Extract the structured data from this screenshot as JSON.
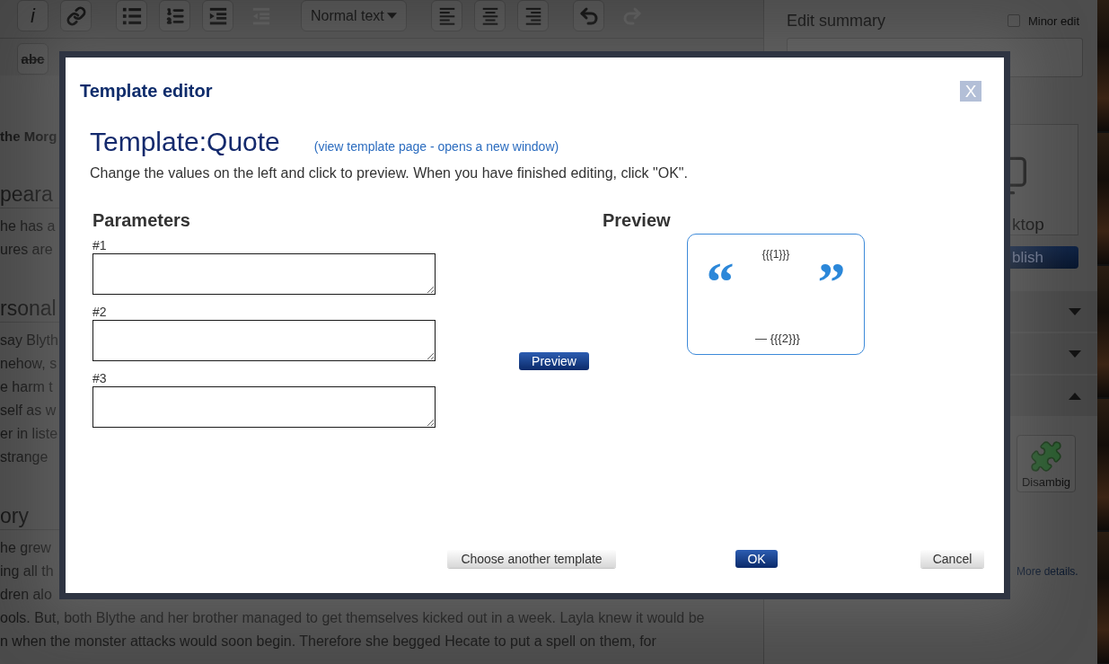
{
  "toolbar": {
    "row_1": [
      {
        "buttons": [
          {
            "kind": "italic",
            "label": "i",
            "disabled": false
          },
          {
            "kind": "link",
            "disabled": false
          }
        ]
      },
      {
        "buttons": [
          {
            "kind": "bullets",
            "disabled": false
          },
          {
            "kind": "numbers",
            "disabled": false
          },
          {
            "kind": "indent",
            "disabled": false
          },
          {
            "kind": "outdent",
            "disabled": true
          }
        ]
      },
      {
        "buttons": [
          {
            "kind": "style",
            "label": "Normal text",
            "disabled": false
          }
        ]
      },
      {
        "buttons": [
          {
            "kind": "align-left",
            "disabled": false
          },
          {
            "kind": "align-center",
            "disabled": false
          },
          {
            "kind": "align-right",
            "disabled": false
          }
        ]
      },
      {
        "buttons": [
          {
            "kind": "undo",
            "disabled": false
          },
          {
            "kind": "redo",
            "disabled": true
          }
        ]
      }
    ],
    "row_2": [
      {
        "buttons": [
          {
            "kind": "strikethrough",
            "label": "abc",
            "disabled": false
          }
        ]
      }
    ]
  },
  "article": {
    "lines": [
      {
        "kind": "bold",
        "text": "the Morg"
      },
      {
        "kind": "heading",
        "text": "peara"
      },
      {
        "kind": "text",
        "text": "he has a"
      },
      {
        "kind": "text",
        "text": "ures are"
      },
      {
        "kind": "heading",
        "text": "rsonal"
      },
      {
        "kind": "text",
        "text": "say Blyth"
      },
      {
        "kind": "text",
        "text": "nehow, s"
      },
      {
        "kind": "text",
        "text": "e harm t"
      },
      {
        "kind": "text",
        "text": "self as w"
      },
      {
        "kind": "text",
        "text": "er in liste"
      },
      {
        "kind": "text",
        "text": "strange"
      },
      {
        "kind": "heading",
        "text": "ory"
      },
      {
        "kind": "text",
        "text": "he grew"
      },
      {
        "kind": "text",
        "text": "ing all th"
      },
      {
        "kind": "text",
        "text": "dren alo"
      },
      {
        "kind": "text",
        "text": "ools. But, both Blythe and her brother managed to get themselves kicked out in a week. Layla knew it would be"
      },
      {
        "kind": "text",
        "text": "n when the monster attacks would soon begin. Therefore she begged Hecate to put a spell on them, for"
      }
    ]
  },
  "sidebar": {
    "summary_label": "Edit summary",
    "minor_edit": {
      "label": "Minor edit",
      "checked": false
    },
    "view_option": "ktop",
    "publish_button": "blish",
    "sections": [
      {
        "expanded": false
      },
      {
        "expanded": false
      },
      {
        "expanded": true
      }
    ],
    "templates": [
      {
        "label": "Disambig"
      }
    ],
    "more_details": "More details."
  },
  "dialog": {
    "title": "Template editor",
    "close": "X",
    "template_name": "Template:Quote",
    "template_link": "(view template page - opens a new window)",
    "instructions": "Change the values on the left and click to preview. When you have finished editing, click \"OK\".",
    "parameters": {
      "heading": "Parameters",
      "fields": [
        {
          "label": "#1"
        },
        {
          "label": "#2"
        },
        {
          "label": "#3"
        }
      ]
    },
    "preview_button": "Preview",
    "preview": {
      "heading": "Preview",
      "quote_open": "“",
      "quote": "{{{1}}}",
      "quote_close": "”",
      "attribution": "— {{{2}}}"
    },
    "buttons": [
      {
        "kind": "choose",
        "label": "Choose another template"
      },
      {
        "kind": "ok",
        "label": "OK"
      },
      {
        "kind": "cancel",
        "label": "Cancel"
      }
    ]
  }
}
